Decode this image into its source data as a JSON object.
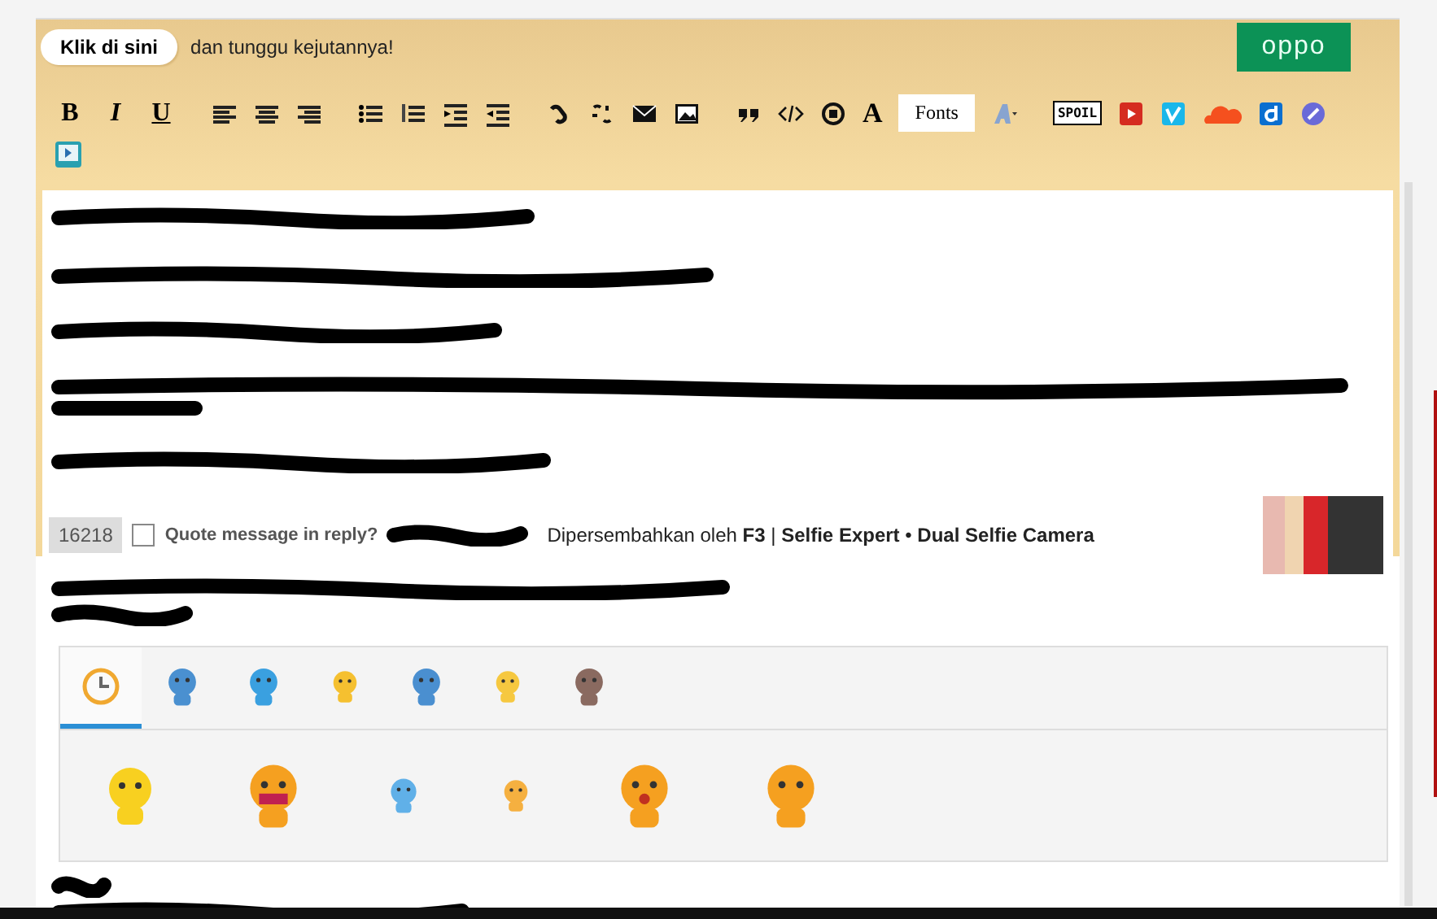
{
  "header": {
    "button": "Klik di sini",
    "text": "dan tunggu kejutannya!",
    "logo": "oppo"
  },
  "toolbar": {
    "format_buttons": [
      "B",
      "I",
      "U"
    ],
    "font_size_button": "A",
    "fonts_button": "Fonts",
    "spoiler_button": "SPOIL"
  },
  "ad": {
    "count": "16218",
    "checkbox": {
      "label": "Quote message in reply?",
      "checked": false
    },
    "sponsor": "Dipersembahkan oleh **F3** | **Selfie Expert** •  **Dual Selfie Camera**"
  },
  "sticker_panel": {
    "tabs": [
      {
        "selected": true
      },
      {
        "selected": false
      },
      {
        "selected": false
      },
      {
        "selected": false
      },
      {
        "selected": false
      },
      {
        "selected": false
      },
      {
        "selected": false
      }
    ]
  }
}
